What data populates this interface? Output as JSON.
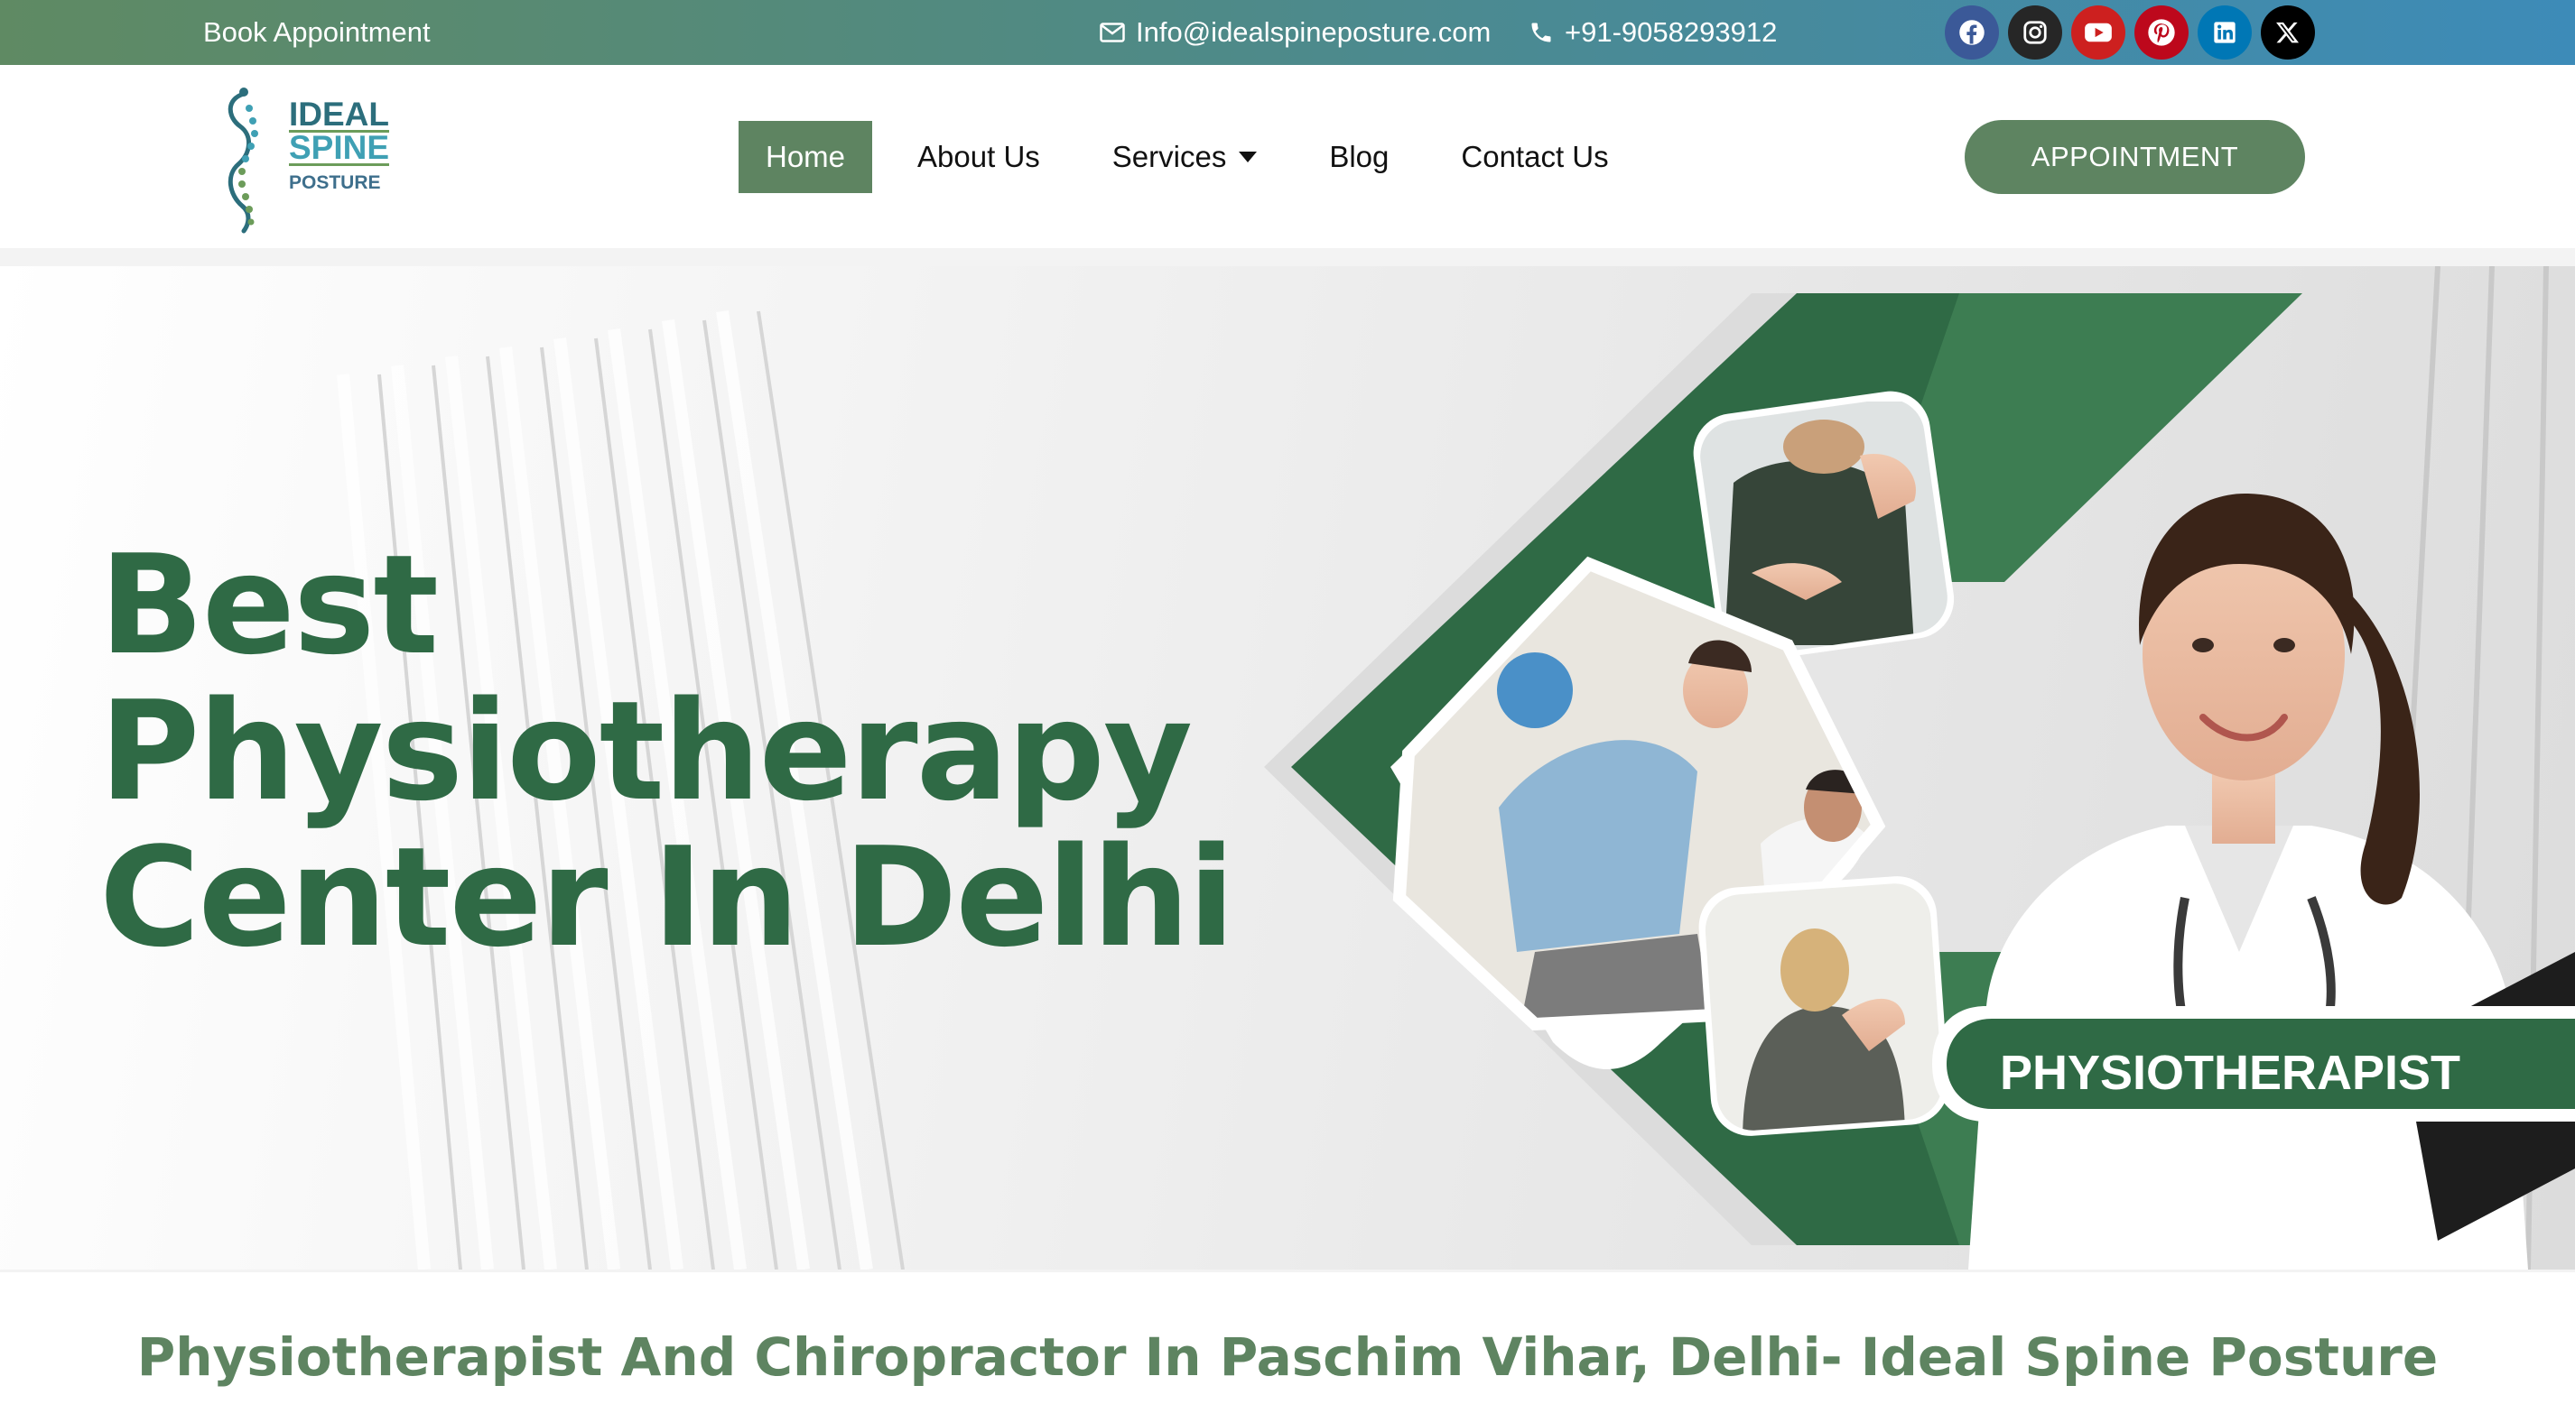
{
  "topbar": {
    "book_label": "Book Appointment",
    "email": "Info@idealspineposture.com",
    "phone": "+91-9058293912",
    "socials": [
      "facebook-icon",
      "instagram-icon",
      "youtube-icon",
      "pinterest-icon",
      "linkedin-icon",
      "x-icon"
    ]
  },
  "logo": {
    "line1": "IDEAL",
    "line2": "SPINE",
    "line3": "POSTURE"
  },
  "nav": {
    "items": [
      {
        "label": "Home",
        "active": true
      },
      {
        "label": "About Us"
      },
      {
        "label": "Services",
        "has_dropdown": true
      },
      {
        "label": "Blog"
      },
      {
        "label": "Contact Us"
      }
    ]
  },
  "cta": {
    "label": "APPOINTMENT"
  },
  "hero": {
    "title_lines": [
      "Best",
      "Physiotherapy",
      "Center In Delhi"
    ],
    "badge": "PHYSIOTHERAPIST"
  },
  "subheading": "Physiotherapist And Chiropractor In Paschim Vihar, Delhi- Ideal Spine Posture",
  "colors": {
    "brand_green": "#5e8461",
    "dark_green": "#2f6a45",
    "top_gradient_start": "#5f8a63",
    "top_gradient_end": "#3d8bb8"
  }
}
